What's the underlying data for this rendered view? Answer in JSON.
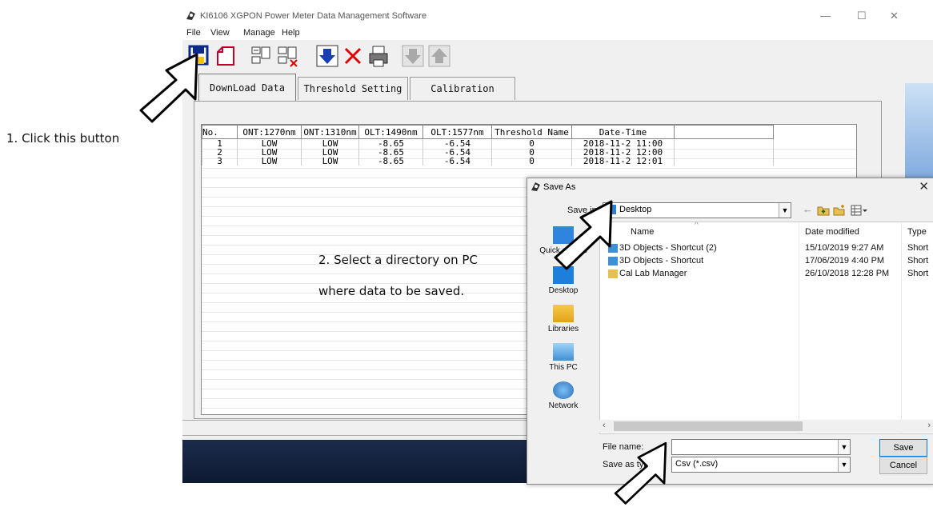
{
  "annotations": {
    "step1": "1. Click this button",
    "step2_line1": "2. Select a directory on PC",
    "step2_line2": "where data to be saved."
  },
  "window": {
    "title": "KI6106 XGPON Power Meter Data Management Software",
    "controls": {
      "minimize": "—",
      "maximize": "☐",
      "close": "✕"
    }
  },
  "menu": [
    "File",
    "View",
    "Manage",
    "Help"
  ],
  "toolbar_icons": [
    "save-icon",
    "open-icon",
    "device-icon",
    "device-delete-icon",
    "download-icon",
    "delete-icon",
    "print-icon",
    "move-down-icon",
    "move-up-icon"
  ],
  "tabs": [
    "DownLoad Data",
    "Threshold Setting",
    "Calibration"
  ],
  "table": {
    "columns": [
      "No.",
      "ONT:1270nm",
      "ONT:1310nm",
      "OLT:1490nm",
      "OLT:1577nm",
      "Threshold Name",
      "Date-Time"
    ],
    "rows": [
      [
        "1",
        "LOW",
        "LOW",
        "-8.65",
        "-6.54",
        "0",
        "2018-11-2 11:00"
      ],
      [
        "2",
        "LOW",
        "LOW",
        "-8.65",
        "-6.54",
        "0",
        "2018-11-2 12:00"
      ],
      [
        "3",
        "LOW",
        "LOW",
        "-8.65",
        "-6.54",
        "0",
        "2018-11-2 12:01"
      ]
    ]
  },
  "dialog": {
    "title": "Save As",
    "close": "✕",
    "save_in_label": "Save in:",
    "save_in_value": "Desktop",
    "places": [
      "Quick access",
      "Desktop",
      "Libraries",
      "This PC",
      "Network"
    ],
    "columns": {
      "name": "Name",
      "date": "Date modified",
      "type": "Type"
    },
    "files": [
      {
        "name": "3D Objects - Shortcut (2)",
        "date": "15/10/2019 9:27 AM",
        "type": "Short"
      },
      {
        "name": "3D Objects - Shortcut",
        "date": "17/06/2019 4:40 PM",
        "type": "Short"
      },
      {
        "name": "Cal Lab Manager",
        "date": "26/10/2018 12:28 PM",
        "type": "Short"
      }
    ],
    "file_name_label": "File name:",
    "file_name_value": "",
    "save_as_type_label": "Save as type:",
    "save_as_type_value": "Csv  (*.csv)",
    "save_button": "Save",
    "cancel_button": "Cancel"
  }
}
